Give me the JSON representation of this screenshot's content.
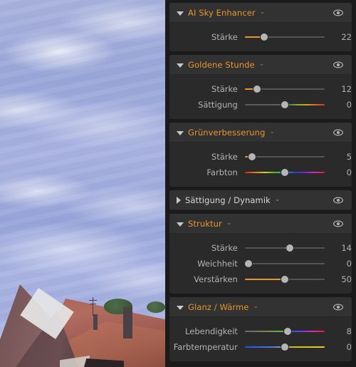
{
  "photo": {
    "alt_description": "Foto: Wolkenhimmel über Hausdächern",
    "sky_color": "#a3aedd",
    "roof_color": "#a9635a"
  },
  "panel": {
    "accent_color": "#e8952a",
    "background": "#2a2a2a",
    "header_background": "#323232",
    "eye_icon": "eye-icon",
    "chevron_glyph": "⌄",
    "sections": [
      {
        "title": "AI Sky Enhancer",
        "expanded": true,
        "visible": true,
        "sliders": [
          {
            "label": "Stärke",
            "value": "22",
            "pos": 22,
            "fill": "left",
            "gradient": "none"
          }
        ]
      },
      {
        "title": "Goldene Stunde",
        "expanded": true,
        "visible": true,
        "sliders": [
          {
            "label": "Stärke",
            "value": "12",
            "pos": 12,
            "fill": "left",
            "gradient": "none"
          },
          {
            "label": "Sättigung",
            "value": "0",
            "pos": 50,
            "fill": "none",
            "gradient": "saturation"
          }
        ]
      },
      {
        "title": "Grünverbesserung",
        "expanded": true,
        "visible": true,
        "sliders": [
          {
            "label": "Stärke",
            "value": "5",
            "pos": 5,
            "fill": "left",
            "gradient": "none"
          },
          {
            "label": "Farbton",
            "value": "0",
            "pos": 50,
            "fill": "none",
            "gradient": "hue"
          }
        ]
      },
      {
        "title": "Sättigung / Dynamik",
        "expanded": false,
        "visible": true,
        "sliders": []
      },
      {
        "title": "Struktur",
        "expanded": true,
        "visible": true,
        "sliders": [
          {
            "label": "Stärke",
            "value": "14",
            "pos": 57,
            "fill": "center",
            "gradient": "none"
          },
          {
            "label": "Weichheit",
            "value": "0",
            "pos": 0,
            "fill": "left",
            "gradient": "none"
          },
          {
            "label": "Verstärken",
            "value": "50",
            "pos": 50,
            "fill": "left",
            "gradient": "none"
          }
        ]
      },
      {
        "title": "Glanz / Wärme",
        "expanded": true,
        "visible": true,
        "sliders": [
          {
            "label": "Lebendigkeit",
            "value": "8",
            "pos": 54,
            "fill": "none",
            "gradient": "vibrance"
          },
          {
            "label": "Farbtemperatur",
            "value": "0",
            "pos": 50,
            "fill": "none",
            "gradient": "temperature"
          }
        ]
      }
    ]
  }
}
